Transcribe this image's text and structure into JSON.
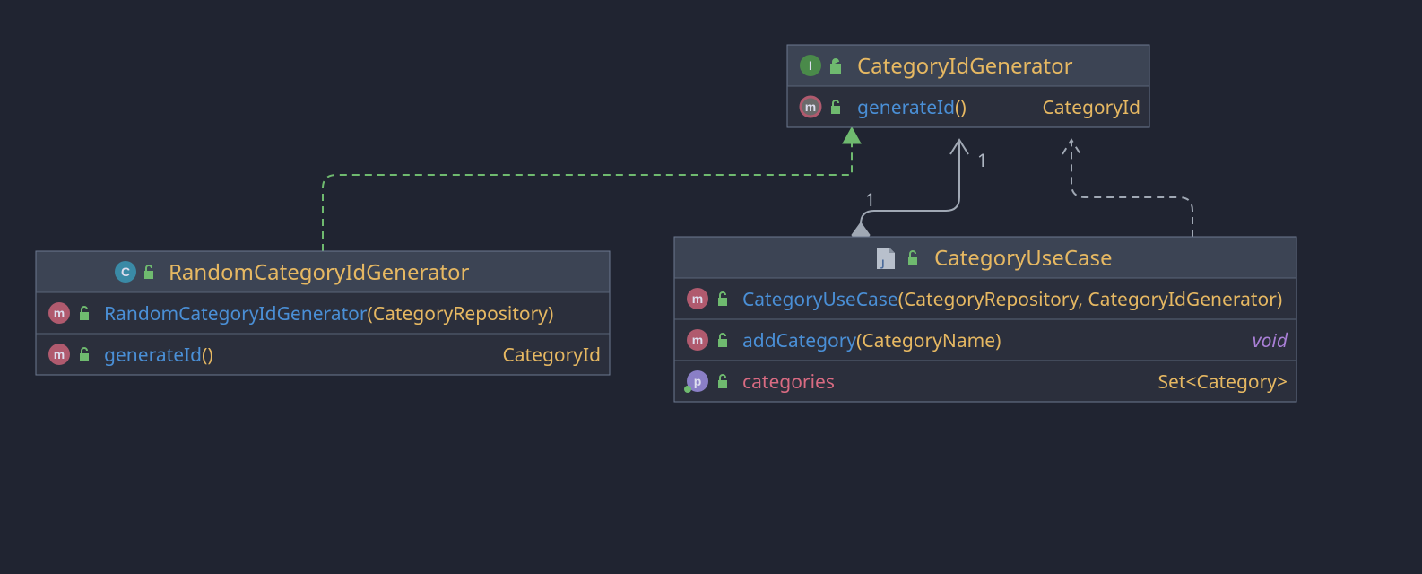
{
  "classes": {
    "catIdGen": {
      "title": "CategoryIdGenerator",
      "kind": "I",
      "rows": [
        {
          "kind": "m_abs",
          "name": "generateId",
          "params": "()",
          "ret": "CategoryId"
        }
      ]
    },
    "randGen": {
      "title": "RandomCategoryIdGenerator",
      "kind": "C",
      "rows": [
        {
          "kind": "m",
          "name": "RandomCategoryIdGenerator",
          "params": "(CategoryRepository)",
          "ret": ""
        },
        {
          "kind": "m",
          "name": "generateId",
          "params": "()",
          "ret": "CategoryId"
        }
      ]
    },
    "useCase": {
      "title": "CategoryUseCase",
      "kind": "J",
      "rows": [
        {
          "kind": "m",
          "name": "CategoryUseCase",
          "params": "(CategoryRepository, CategoryIdGenerator)",
          "ret": ""
        },
        {
          "kind": "m",
          "name": "addCategory",
          "params": "(CategoryName)",
          "ret": "void"
        },
        {
          "kind": "p",
          "name": "categories",
          "params": "",
          "ret": "Set<Category>"
        }
      ]
    }
  },
  "mult": {
    "a": "1",
    "b": "1"
  }
}
